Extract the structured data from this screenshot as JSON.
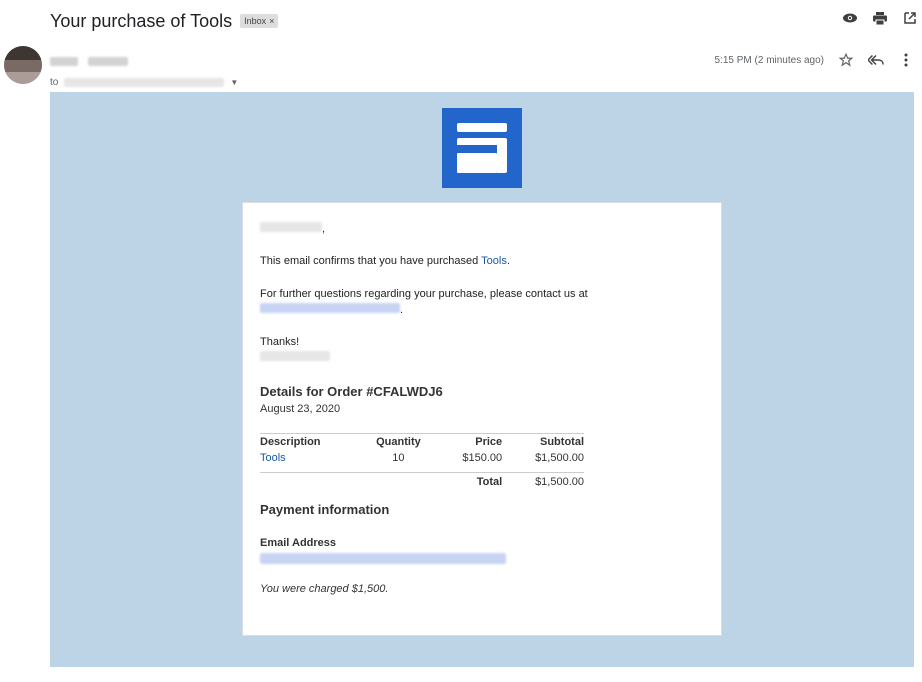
{
  "header": {
    "subject": "Your purchase of Tools",
    "label": "Inbox",
    "label_close": "×"
  },
  "icons": {
    "hide_images": "eye-icon",
    "print": "printer-icon",
    "open_new": "open-in-new-window-icon",
    "star": "star-icon",
    "reply_all": "reply-all-icon",
    "more": "more-vert-icon",
    "caret": "chevron-down-icon"
  },
  "message": {
    "to_prefix": "to",
    "time": "5:15 PM (2 minutes ago)"
  },
  "body": {
    "brand_color": "#2266cc",
    "background_color": "#bdd4e7",
    "confirm_prefix": "This email confirms that you have purchased ",
    "confirm_link": "Tools",
    "confirm_suffix": ".",
    "questions": "For further questions regarding your purchase, please contact us at",
    "thanks": "Thanks!",
    "order_title": "Details for Order #CFALWDJ6",
    "order_date": "August 23, 2020",
    "table": {
      "headers": [
        "Description",
        "Quantity",
        "Price",
        "Subtotal"
      ],
      "rows": [
        {
          "description": "Tools",
          "quantity": "10",
          "price": "$150.00",
          "subtotal": "$1,500.00"
        }
      ],
      "total_label": "Total",
      "total_value": "$1,500.00"
    },
    "payment_title": "Payment information",
    "email_label": "Email Address",
    "charged": "You were charged $1,500."
  }
}
